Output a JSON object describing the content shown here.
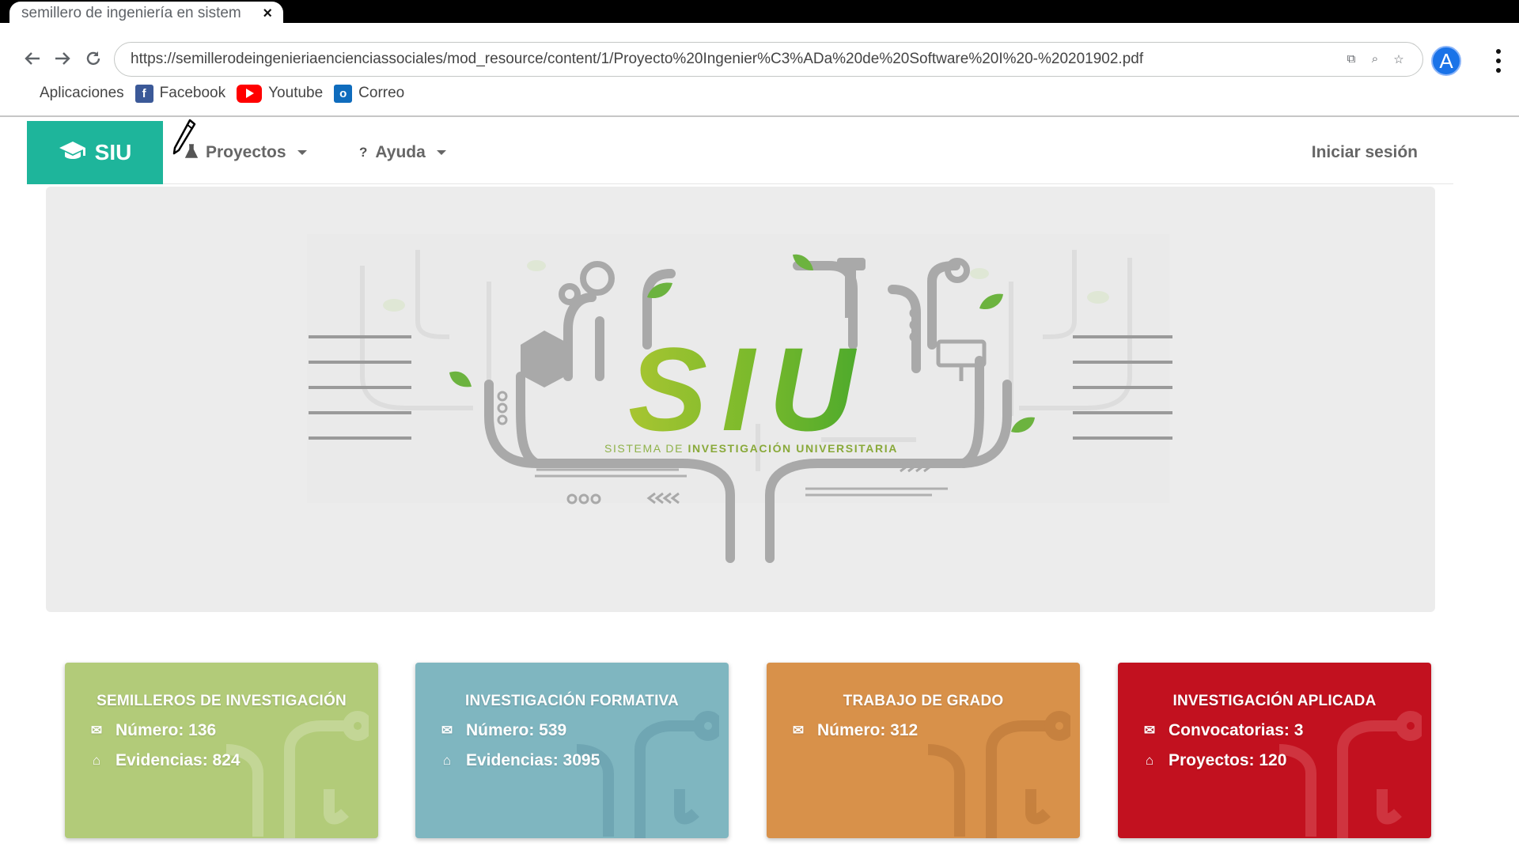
{
  "browser": {
    "tab_title": "semillero de ingeniería en sistem",
    "tab_close": "×",
    "url": "https://semillerodeingenieriaencienciassociales/mod_resource/content/1/Proyecto%20Ingenier%C3%ADa%20de%20Software%20I%20-%20201902.pdf",
    "profile_initial": "A",
    "bookmarks": [
      {
        "label": "Aplicaciones",
        "icon": "apps-icon"
      },
      {
        "label": "Facebook",
        "icon": "facebook-icon",
        "color": "#3b5998"
      },
      {
        "label": "Youtube",
        "icon": "youtube-icon",
        "color": "#ff0000"
      },
      {
        "label": "Correo",
        "icon": "outlook-icon",
        "color": "#0f6cbd"
      }
    ]
  },
  "navbar": {
    "brand": "SIU",
    "brand_color": "#1eb59b",
    "items": [
      {
        "label": "Proyectos",
        "icon": "flask-icon"
      },
      {
        "label": "Ayuda",
        "icon": "question-icon"
      }
    ],
    "login": "Iniciar sesión"
  },
  "hero": {
    "logo_text": "SIU",
    "tagline_prefix": "SISTEMA DE ",
    "tagline_bold": "INVESTIGACIÓN UNIVERSITARIA"
  },
  "cards": [
    {
      "title": "SEMILLEROS DE INVESTIGACIÓN",
      "color": "#b2cb79",
      "lines": [
        {
          "icon": "envelope-icon",
          "text": "Número: 136"
        },
        {
          "icon": "home-icon",
          "text": "Evidencias: 824"
        }
      ]
    },
    {
      "title": "INVESTIGACIÓN FORMATIVA",
      "color": "#7fb6c0",
      "lines": [
        {
          "icon": "envelope-icon",
          "text": "Número: 539"
        },
        {
          "icon": "home-icon",
          "text": "Evidencias: 3095"
        }
      ]
    },
    {
      "title": "TRABAJO DE GRADO",
      "color": "#d8914a",
      "lines": [
        {
          "icon": "envelope-icon",
          "text": "Número: 312"
        }
      ]
    },
    {
      "title": "INVESTIGACIÓN APLICADA",
      "color": "#c2111f",
      "lines": [
        {
          "icon": "envelope-icon",
          "text": "Convocatorias: 3"
        },
        {
          "icon": "home-icon",
          "text": "Proyectos: 120"
        }
      ]
    }
  ]
}
